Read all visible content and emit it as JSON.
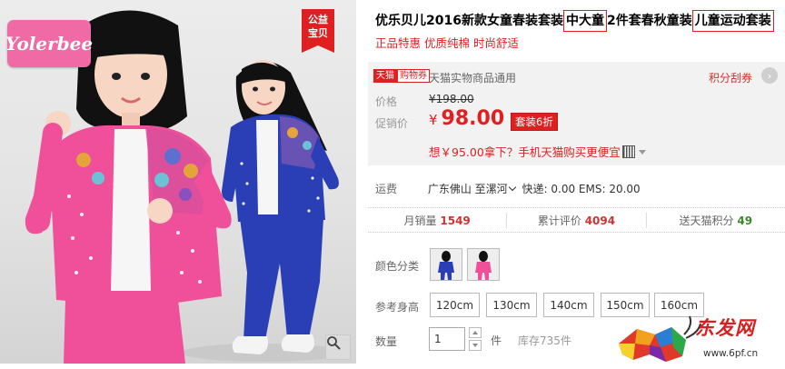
{
  "image": {
    "logo_text": "Yolerbee",
    "charity_tag": [
      "公益",
      "宝贝"
    ],
    "zoom_icon": "magnifier-icon"
  },
  "product": {
    "title_part1": "优乐贝儿2016新款女童春装套装",
    "title_boxed1": "中大童",
    "title_part2": "2件套春秋童装",
    "title_boxed2": "儿童运动套装",
    "subtitle": "正品特惠 优质纯棉 时尚舒适"
  },
  "price_panel": {
    "badge_tmall": "天猫",
    "badge_voucher": "购物券",
    "voucher_text": "天猫实物商品通用",
    "points_link": "积分刮券",
    "price_label": "价格",
    "original_price": "¥198.00",
    "promo_label": "促销价",
    "currency": "¥",
    "promo_price": "98.00",
    "discount_tag": "套装6折",
    "app_offer": "想￥95.00拿下？手机天猫购买更便宜"
  },
  "shipping": {
    "label": "运费",
    "from": "广东佛山",
    "to": "至漯河",
    "fees": "快递: 0.00 EMS: 20.00"
  },
  "stats": [
    {
      "label": "月销量",
      "value": "1549"
    },
    {
      "label": "累计评价",
      "value": "4094"
    },
    {
      "label": "送天猫积分",
      "value": "49"
    }
  ],
  "options": {
    "color_label": "颜色分类",
    "size_label": "参考身高",
    "sizes": [
      "120cm",
      "130cm",
      "140cm",
      "150cm",
      "160cm"
    ],
    "qty_label": "数量",
    "qty_value": "1",
    "qty_unit": "件",
    "stock": "库存735件"
  },
  "watermark": {
    "text": "东发网",
    "url": "www.6pf.cn"
  },
  "colors": {
    "accent_red": "#e02020",
    "panel_gray": "#f2f2f2",
    "pink": "#f06aa5",
    "blue": "#2a3fb5"
  }
}
